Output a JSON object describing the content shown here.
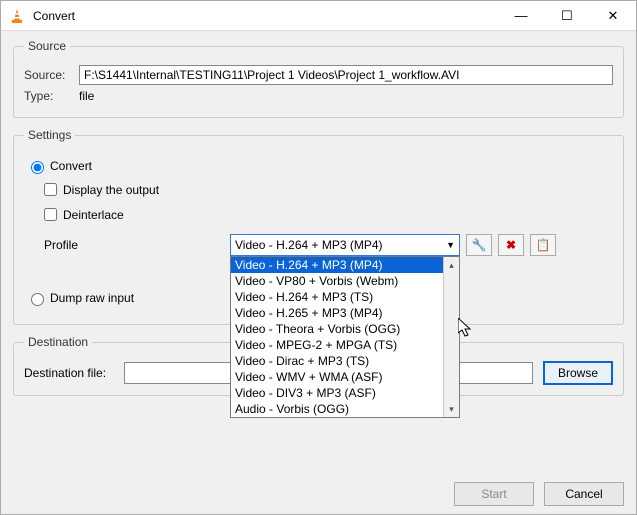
{
  "window": {
    "title": "Convert",
    "min": "—",
    "max": "☐",
    "close": "✕"
  },
  "source": {
    "legend": "Source",
    "source_label": "Source:",
    "source_value": "F:\\S1441\\Internal\\TESTING11\\Project 1 Videos\\Project 1_workflow.AVI",
    "type_label": "Type:",
    "type_value": "file"
  },
  "settings": {
    "legend": "Settings",
    "convert_label": "Convert",
    "display_output_label": "Display the output",
    "deinterlace_label": "Deinterlace",
    "profile_label": "Profile",
    "profile_selected": "Video - H.264 + MP3 (MP4)",
    "profile_options": [
      "Video - H.264 + MP3 (MP4)",
      "Video - VP80 + Vorbis (Webm)",
      "Video - H.264 + MP3 (TS)",
      "Video - H.265 + MP3 (MP4)",
      "Video - Theora + Vorbis (OGG)",
      "Video - MPEG-2 + MPGA (TS)",
      "Video - Dirac + MP3 (TS)",
      "Video - WMV + WMA (ASF)",
      "Video - DIV3 + MP3 (ASF)",
      "Audio - Vorbis (OGG)"
    ],
    "dump_raw_label": "Dump raw input",
    "icons": {
      "tools": "🔧",
      "delete": "✖",
      "new": "📋"
    }
  },
  "destination": {
    "legend": "Destination",
    "file_label": "Destination file:",
    "file_value": "",
    "browse_label": "Browse"
  },
  "footer": {
    "start_label": "Start",
    "cancel_label": "Cancel"
  }
}
